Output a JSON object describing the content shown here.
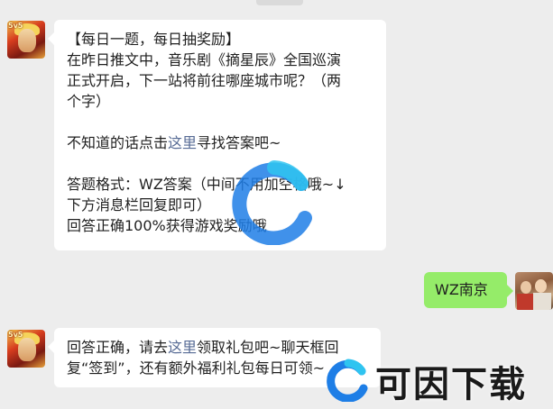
{
  "messages": [
    {
      "side": "left",
      "avatar": "honor-of-kings-avatar",
      "lines": [
        "【每日一题，每日抽奖励】",
        "在昨日推文中，音乐剧《摘星辰》全国巡演",
        "正式开启，下一站将前往哪座城市呢？（两",
        "个字）"
      ],
      "hint_prefix": "不知道的话点击",
      "hint_link": "这里",
      "hint_suffix": "寻找答案吧~",
      "format_lines": [
        "答题格式：WZ答案（中间不用加空格哦~↓",
        "下方消息栏回复即可）",
        "回答正确100%获得游戏奖励哦"
      ]
    },
    {
      "side": "right",
      "avatar": "user-avatar",
      "text": "WZ南京"
    },
    {
      "side": "left",
      "avatar": "honor-of-kings-avatar",
      "line1_prefix": "回答正确，请去",
      "line1_link": "这里",
      "line1_suffix": "领取礼包吧~聊天框回",
      "line2": "复“签到”，还有额外福利礼包每日可领~"
    }
  ],
  "avatar_badge": "5v5",
  "watermark": {
    "text": "可因下载",
    "logo_color": "#1e7ee6"
  },
  "colors": {
    "background": "#ededed",
    "bubble_left": "#ffffff",
    "bubble_right": "#95ec69",
    "link": "#576b95"
  }
}
